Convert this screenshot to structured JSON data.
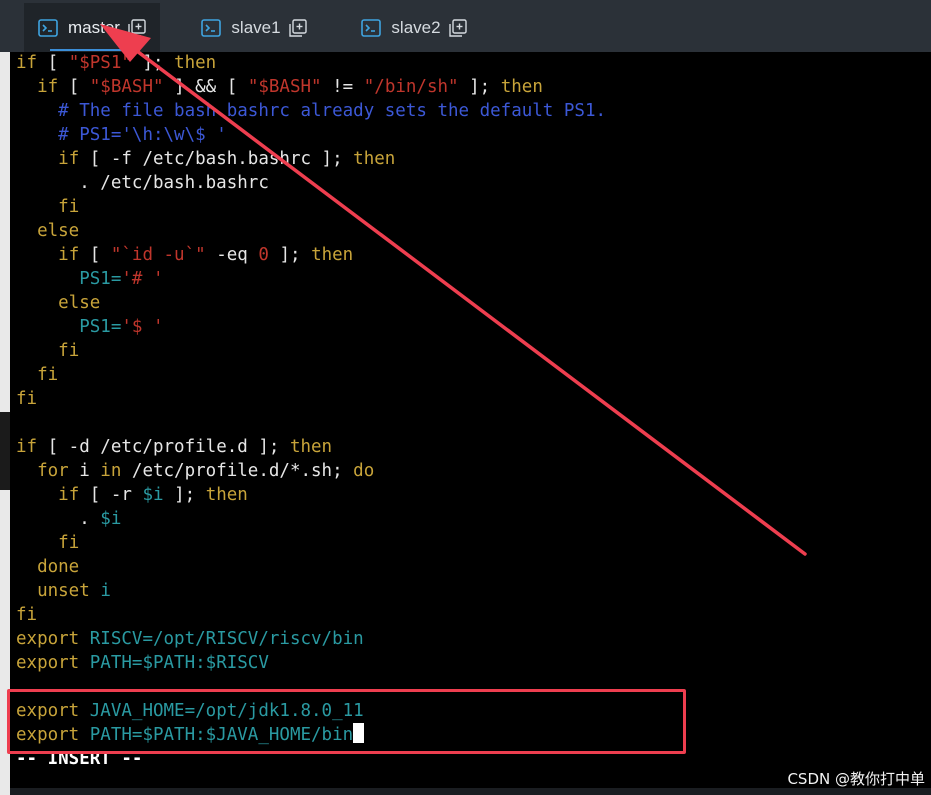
{
  "tabs": [
    {
      "label": "master",
      "active": true,
      "icon": "terminal-icon",
      "action_icon": "duplicate-icon"
    },
    {
      "label": "slave1",
      "active": false,
      "icon": "terminal-icon",
      "action_icon": "duplicate-icon"
    },
    {
      "label": "slave2",
      "active": false,
      "icon": "terminal-icon",
      "action_icon": "duplicate-icon"
    }
  ],
  "terminal": {
    "lines": [
      [
        [
          "kw",
          "if"
        ],
        [
          "tx",
          " [ "
        ],
        [
          "str",
          "\"$PS1\""
        ],
        [
          "tx",
          " ]; "
        ],
        [
          "kw",
          "then"
        ]
      ],
      [
        [
          "tx",
          "  "
        ],
        [
          "kw",
          "if"
        ],
        [
          "tx",
          " [ "
        ],
        [
          "str",
          "\"$BASH\""
        ],
        [
          "tx",
          " ] && [ "
        ],
        [
          "str",
          "\"$BASH\""
        ],
        [
          "tx",
          " != "
        ],
        [
          "str",
          "\"/bin/sh\""
        ],
        [
          "tx",
          " ]; "
        ],
        [
          "kw",
          "then"
        ]
      ],
      [
        [
          "tx",
          "    "
        ],
        [
          "cm",
          "# The file bash.bashrc already sets the default PS1."
        ]
      ],
      [
        [
          "tx",
          "    "
        ],
        [
          "cm",
          "# PS1='\\h:\\w\\$ '"
        ]
      ],
      [
        [
          "tx",
          "    "
        ],
        [
          "kw",
          "if"
        ],
        [
          "tx",
          " [ -f /etc/bash.bashrc ]; "
        ],
        [
          "kw",
          "then"
        ]
      ],
      [
        [
          "tx",
          "      . /etc/bash.bashrc"
        ]
      ],
      [
        [
          "tx",
          "    "
        ],
        [
          "kw",
          "fi"
        ]
      ],
      [
        [
          "tx",
          "  "
        ],
        [
          "kw",
          "else"
        ]
      ],
      [
        [
          "tx",
          "    "
        ],
        [
          "kw",
          "if"
        ],
        [
          "tx",
          " [ "
        ],
        [
          "str",
          "\"`id -u`\""
        ],
        [
          "tx",
          " -eq "
        ],
        [
          "str",
          "0"
        ],
        [
          "tx",
          " ]; "
        ],
        [
          "kw",
          "then"
        ]
      ],
      [
        [
          "tx",
          "      "
        ],
        [
          "var",
          "PS1="
        ],
        [
          "str",
          "'# '"
        ]
      ],
      [
        [
          "tx",
          "    "
        ],
        [
          "kw",
          "else"
        ]
      ],
      [
        [
          "tx",
          "      "
        ],
        [
          "var",
          "PS1="
        ],
        [
          "str",
          "'$ '"
        ]
      ],
      [
        [
          "tx",
          "    "
        ],
        [
          "kw",
          "fi"
        ]
      ],
      [
        [
          "tx",
          "  "
        ],
        [
          "kw",
          "fi"
        ]
      ],
      [
        [
          "kw",
          "fi"
        ]
      ],
      [
        [
          "tx",
          ""
        ]
      ],
      [
        [
          "kw",
          "if"
        ],
        [
          "tx",
          " [ -d /etc/profile.d ]; "
        ],
        [
          "kw",
          "then"
        ]
      ],
      [
        [
          "tx",
          "  "
        ],
        [
          "kw",
          "for"
        ],
        [
          "tx",
          " i "
        ],
        [
          "kw",
          "in"
        ],
        [
          "tx",
          " /etc/profile.d/*.sh; "
        ],
        [
          "kw",
          "do"
        ]
      ],
      [
        [
          "tx",
          "    "
        ],
        [
          "kw",
          "if"
        ],
        [
          "tx",
          " [ -r "
        ],
        [
          "var",
          "$i"
        ],
        [
          "tx",
          " ]; "
        ],
        [
          "kw",
          "then"
        ]
      ],
      [
        [
          "tx",
          "      . "
        ],
        [
          "var",
          "$i"
        ]
      ],
      [
        [
          "tx",
          "    "
        ],
        [
          "kw",
          "fi"
        ]
      ],
      [
        [
          "tx",
          "  "
        ],
        [
          "kw",
          "done"
        ]
      ],
      [
        [
          "tx",
          "  "
        ],
        [
          "kw",
          "unset"
        ],
        [
          "tx",
          " "
        ],
        [
          "var",
          "i"
        ]
      ],
      [
        [
          "kw",
          "fi"
        ]
      ],
      [
        [
          "kw",
          "export"
        ],
        [
          "tx",
          " "
        ],
        [
          "var",
          "RISCV=/opt/RISCV/riscv/bin"
        ]
      ],
      [
        [
          "kw",
          "export"
        ],
        [
          "tx",
          " "
        ],
        [
          "var",
          "PATH=$PATH:$RISCV"
        ]
      ],
      [
        [
          "tx",
          ""
        ]
      ],
      [
        [
          "kw",
          "export"
        ],
        [
          "tx",
          " "
        ],
        [
          "var",
          "JAVA_HOME=/opt/jdk1.8.0_11"
        ]
      ],
      [
        [
          "kw",
          "export"
        ],
        [
          "tx",
          " "
        ],
        [
          "var",
          "PATH=$PATH:$JAVA_HOME/bin"
        ],
        [
          "cursor",
          ""
        ]
      ]
    ],
    "status": "-- INSERT --"
  },
  "colors": {
    "keyword": "#c8a43a",
    "string": "#c0362c",
    "variable": "#2a9aa2",
    "comment": "#3c58d6",
    "annotation": "#ee3e4f"
  },
  "watermark": "CSDN @教你打中单"
}
